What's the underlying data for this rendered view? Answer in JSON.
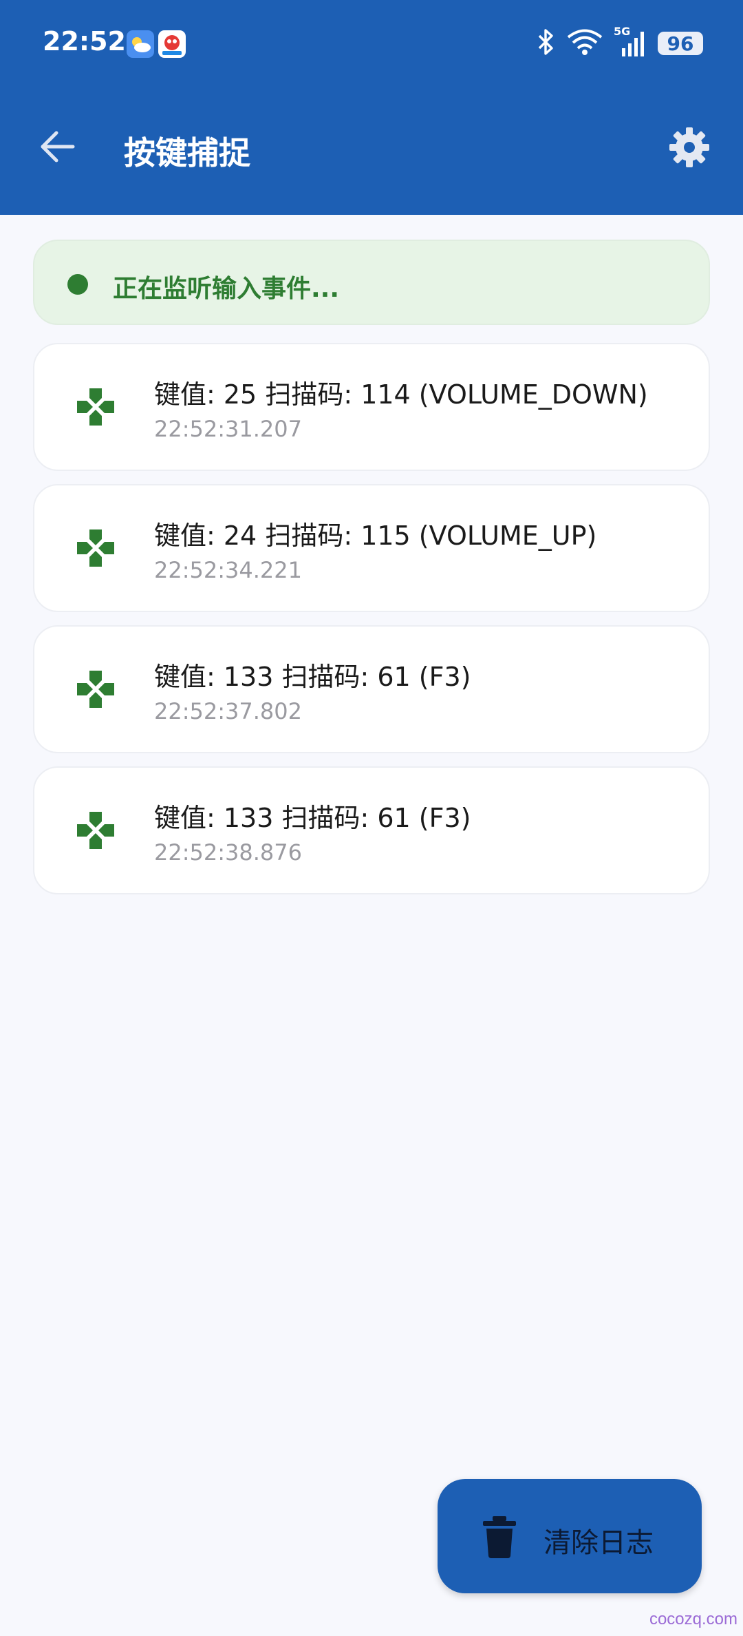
{
  "status_bar": {
    "time": "22:52",
    "icons": [
      "weather-app-icon",
      "game-app-icon",
      "bluetooth-icon",
      "wifi-icon",
      "signal-5g-icon"
    ],
    "network_label": "5G",
    "battery": "96"
  },
  "header": {
    "title": "按键捕捉",
    "back_icon": "arrow-left-icon",
    "settings_icon": "gear-icon"
  },
  "banner": {
    "text": "正在监听输入事件...",
    "color": "#2e7d32"
  },
  "events": [
    {
      "title": "键值: 25 扫描码: 114  (VOLUME_DOWN)",
      "time": "22:52:31.207",
      "icon": "gamepad-icon"
    },
    {
      "title": "键值: 24 扫描码: 115  (VOLUME_UP)",
      "time": "22:52:34.221",
      "icon": "gamepad-icon"
    },
    {
      "title": "键值: 133 扫描码: 61  (F3)",
      "time": "22:52:37.802",
      "icon": "gamepad-icon"
    },
    {
      "title": "键值: 133 扫描码: 61  (F3)",
      "time": "22:52:38.876",
      "icon": "gamepad-icon"
    }
  ],
  "fab": {
    "label": "清除日志",
    "icon": "trash-icon"
  },
  "watermark": "cocozq.com",
  "colors": {
    "primary": "#1d5fb4",
    "background": "#f7f8fd",
    "accent_green": "#2e7d32"
  }
}
